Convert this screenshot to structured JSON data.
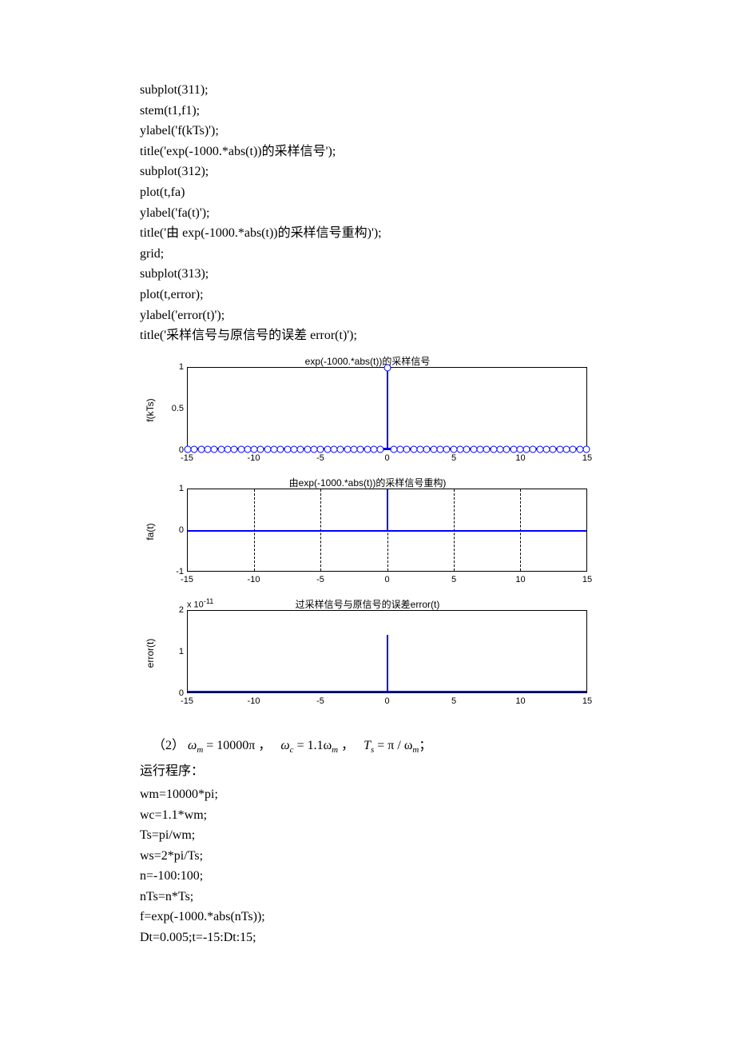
{
  "code_top": "subplot(311);\nstem(t1,f1);\nylabel('f(kTs)');\ntitle('exp(-1000.*abs(t))的采样信号');\nsubplot(312);\nplot(t,fa)\nylabel('fa(t)');\ntitle('由 exp(-1000.*abs(t))的采样信号重构)');\ngrid;\nsubplot(313);\nplot(t,error);\nylabel('error(t)');\ntitle('采样信号与原信号的误差 error(t)');",
  "chart_data": [
    {
      "type": "stem",
      "title": "exp(-1000.*abs(t))的采样信号",
      "ylabel": "f(kTs)",
      "xlim": [
        -15,
        15
      ],
      "ylim": [
        0,
        1
      ],
      "xticks": [
        -15,
        -10,
        -5,
        0,
        5,
        10,
        15
      ],
      "yticks": [
        0,
        0.5,
        1
      ],
      "baseline_circles_step": 0.5,
      "peak": {
        "x": 0,
        "y": 1
      }
    },
    {
      "type": "line",
      "title": "由exp(-1000.*abs(t))的采样信号重构)",
      "ylabel": "fa(t)",
      "xlim": [
        -15,
        15
      ],
      "ylim": [
        -1,
        1
      ],
      "xticks": [
        -15,
        -10,
        -5,
        0,
        5,
        10,
        15
      ],
      "yticks": [
        -1,
        0,
        1
      ],
      "grid": true,
      "peak": {
        "x": 0,
        "y_from": 0,
        "y_to": 1
      }
    },
    {
      "type": "line",
      "title": "过采样信号与原信号的误差error(t)",
      "ylabel": "error(t)",
      "scale_text": "x 10",
      "scale_exp": "-11",
      "xlim": [
        -15,
        15
      ],
      "ylim": [
        0,
        2
      ],
      "xticks": [
        -15,
        -10,
        -5,
        0,
        5,
        10,
        15
      ],
      "yticks": [
        0,
        1,
        2
      ],
      "peak": {
        "x": 0,
        "y_from": 0,
        "y_to": 1.4
      }
    }
  ],
  "math": {
    "item_prefix": "（2）",
    "omega_m_lhs": "ω",
    "omega_m_sub": "m",
    "eq1_rhs": " = 10000π ，",
    "omega_c_lhs": "ω",
    "omega_c_sub": "c",
    "eq2_rhs": " = 1.1ω",
    "eq2_end": " ，",
    "T_lhs": "T",
    "T_sub": "s",
    "eq3_rhs": " = π / ω",
    "eq3_end": "；",
    "run_label": "运行程序：",
    "code_bottom": "wm=10000*pi;\nwc=1.1*wm;\nTs=pi/wm;\nws=2*pi/Ts;\nn=-100:100;\nnTs=n*Ts;\nf=exp(-1000.*abs(nTs));\nDt=0.005;t=-15:Dt:15;"
  }
}
